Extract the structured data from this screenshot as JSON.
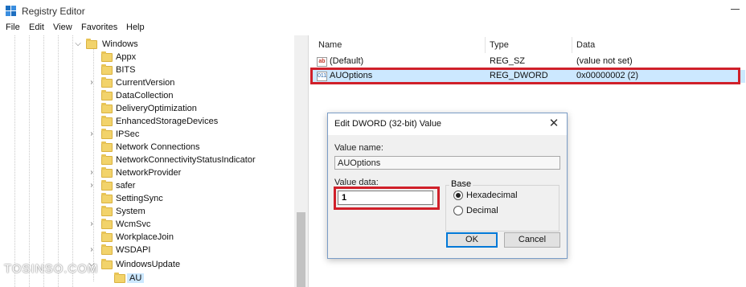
{
  "window": {
    "title": "Registry Editor"
  },
  "menu": [
    "File",
    "Edit",
    "View",
    "Favorites",
    "Help"
  ],
  "tree": {
    "parent": "Windows",
    "items": [
      {
        "label": "Appx",
        "expandable": false
      },
      {
        "label": "BITS",
        "expandable": false
      },
      {
        "label": "CurrentVersion",
        "expandable": true
      },
      {
        "label": "DataCollection",
        "expandable": false
      },
      {
        "label": "DeliveryOptimization",
        "expandable": false
      },
      {
        "label": "EnhancedStorageDevices",
        "expandable": false
      },
      {
        "label": "IPSec",
        "expandable": true
      },
      {
        "label": "Network Connections",
        "expandable": false
      },
      {
        "label": "NetworkConnectivityStatusIndicator",
        "expandable": false
      },
      {
        "label": "NetworkProvider",
        "expandable": true
      },
      {
        "label": "safer",
        "expandable": true
      },
      {
        "label": "SettingSync",
        "expandable": false
      },
      {
        "label": "System",
        "expandable": false
      },
      {
        "label": "WcmSvc",
        "expandable": true
      },
      {
        "label": "WorkplaceJoin",
        "expandable": false
      },
      {
        "label": "WSDAPI",
        "expandable": true
      },
      {
        "label": "WindowsUpdate",
        "expandable": false
      }
    ],
    "child": "AU"
  },
  "list": {
    "columns": [
      "Name",
      "Type",
      "Data"
    ],
    "rows": [
      {
        "icon": "string-value-icon",
        "name": "(Default)",
        "type": "REG_SZ",
        "data": "(value not set)"
      },
      {
        "icon": "dword-value-icon",
        "name": "AUOptions",
        "type": "REG_DWORD",
        "data": "0x00000002 (2)"
      }
    ]
  },
  "dialog": {
    "title": "Edit DWORD (32-bit) Value",
    "value_name_label": "Value name:",
    "value_name": "AUOptions",
    "value_data_label": "Value data:",
    "value_data": "1",
    "base_label": "Base",
    "radios": [
      {
        "label": "Hexadecimal",
        "checked": true
      },
      {
        "label": "Decimal",
        "checked": false
      }
    ],
    "ok": "OK",
    "cancel": "Cancel"
  },
  "watermark": "TOSINSO.COM",
  "colors": {
    "highlight_border": "#d0202a",
    "selection": "#cce8ff",
    "folder": "#f2d36b"
  }
}
